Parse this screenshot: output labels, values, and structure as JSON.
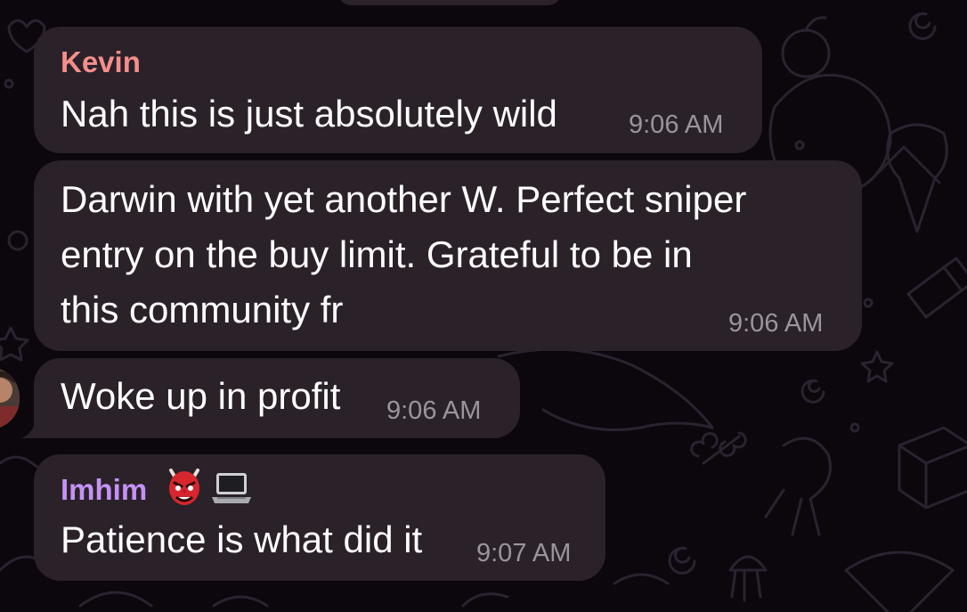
{
  "theme": {
    "background": "#0b070d",
    "bubble": "#2a2129",
    "text": "#ffffff",
    "timestamp": "#9c949b"
  },
  "messages": [
    {
      "sender": "Kevin",
      "sender_color": "#f48e8b",
      "lines": [
        "Nah this is just absolutely wild"
      ],
      "time": "9:06 AM"
    },
    {
      "lines": [
        "Darwin with yet another W. Perfect sniper",
        "entry on the buy limit. Grateful to be in",
        "this community fr"
      ],
      "time": "9:06 AM"
    },
    {
      "lines": [
        "Woke up in profit"
      ],
      "time": "9:06 AM",
      "has_avatar": true
    },
    {
      "sender": "Imhim",
      "sender_color": "#c492f4",
      "sender_emojis": [
        "japanese-goblin-emoji",
        "laptop-emoji"
      ],
      "lines": [
        "Patience is what did it"
      ],
      "time": "9:07 AM"
    }
  ]
}
